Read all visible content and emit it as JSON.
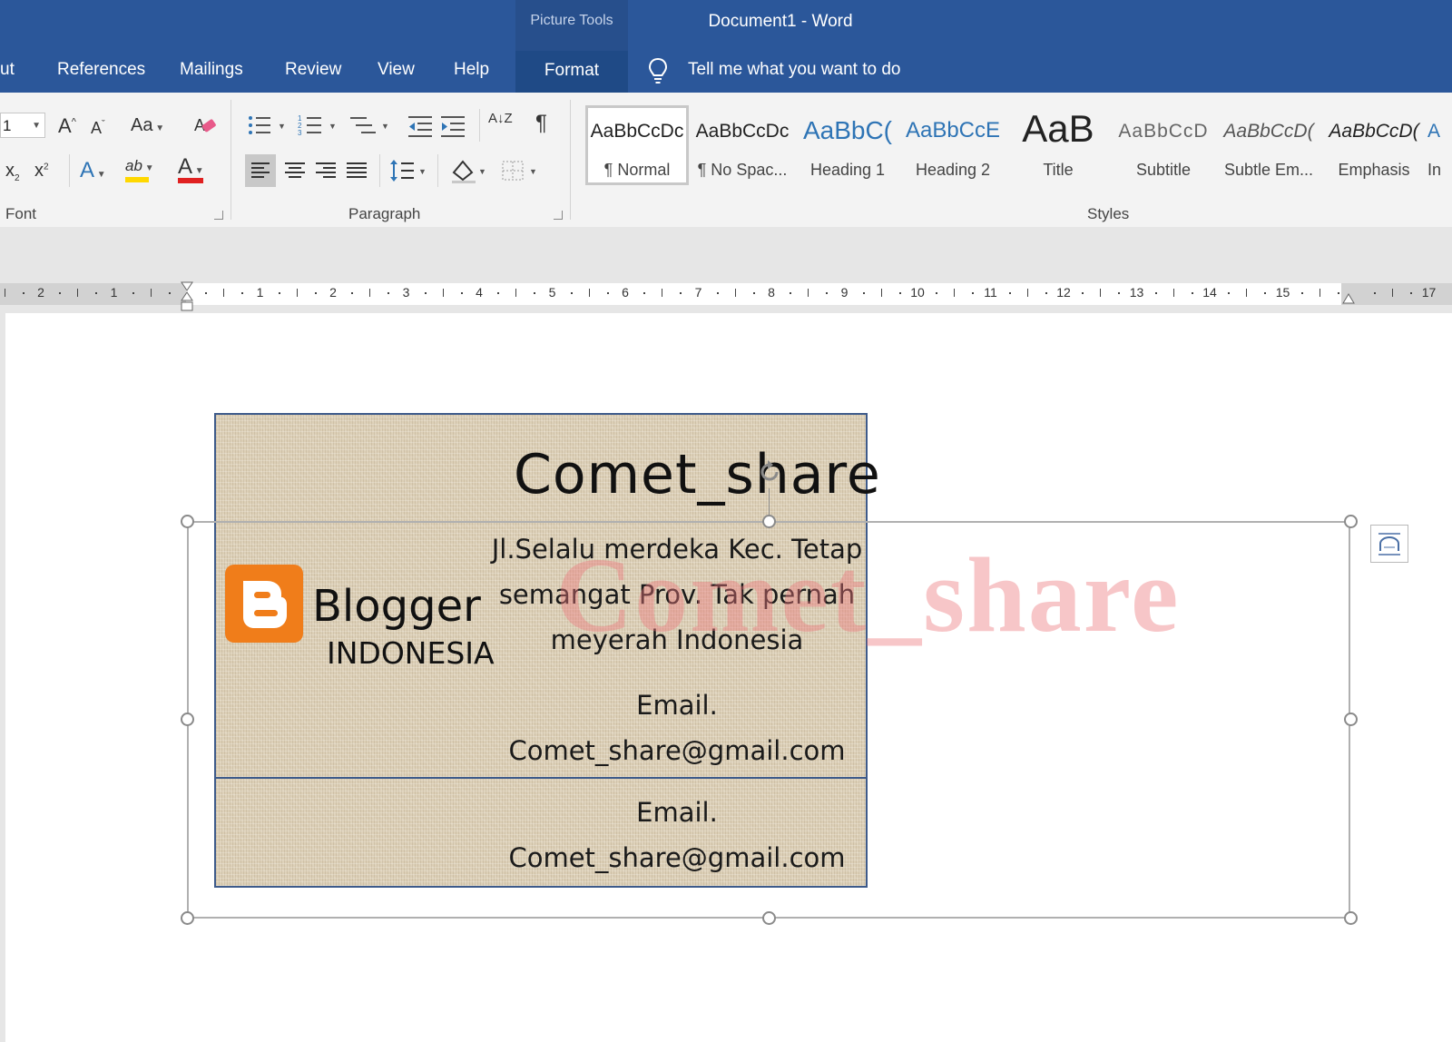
{
  "window": {
    "context_tab_group": "Picture Tools",
    "title": "Document1  -  Word"
  },
  "tabs": {
    "layout_partial": "ut",
    "references": "References",
    "mailings": "Mailings",
    "review": "Review",
    "view": "View",
    "help": "Help",
    "format": "Format",
    "tell_me": "Tell me what you want to do",
    "tell_me_icon": "lightbulb-icon"
  },
  "ribbon": {
    "font": {
      "size_value": "1",
      "grow_label": "A",
      "shrink_label": "A",
      "change_case_label": "Aa",
      "subscript_label": "x",
      "superscript_label": "x",
      "text_effects_label": "A",
      "highlight_label": "ab",
      "font_color_label": "A",
      "group_label": "Font",
      "highlight_color": "#ffd800",
      "font_color": "#e02020"
    },
    "paragraph": {
      "group_label": "Paragraph",
      "sort_label": "A↓Z",
      "show_marks_label": "¶"
    },
    "styles": {
      "group_label": "Styles",
      "items": [
        {
          "sample": "AaBbCcDc",
          "name": "¶ Normal"
        },
        {
          "sample": "AaBbCcDc",
          "name": "¶ No Spac..."
        },
        {
          "sample": "AaBbC(",
          "name": "Heading 1"
        },
        {
          "sample": "AaBbCcE",
          "name": "Heading 2"
        },
        {
          "sample": "AaB",
          "name": "Title"
        },
        {
          "sample": "AaBbCcD",
          "name": "Subtitle"
        },
        {
          "sample": "AaBbCcD(",
          "name": "Subtle Em..."
        },
        {
          "sample": "AaBbCcD(",
          "name": "Emphasis"
        },
        {
          "sample": "A",
          "name": "In"
        }
      ],
      "heading_color": "#2e74b5"
    }
  },
  "ruler": {
    "left_numbers": [
      "2",
      "1"
    ],
    "right_numbers": [
      "1",
      "2",
      "3",
      "4",
      "5",
      "6",
      "7",
      "8",
      "9",
      "10",
      "11",
      "12",
      "13",
      "14",
      "15",
      "17"
    ]
  },
  "document": {
    "card": {
      "title": "Comet_share",
      "address_line1": "Jl.Selalu merdeka Kec. Tetap",
      "address_line2": "semangat Prov. Tak pernah",
      "address_line3": "meyerah Indonesia",
      "email_label": "Email.",
      "email_value": "Comet_share@gmail.com",
      "email_label_2": "Email.",
      "email_value_2": "Comet_share@gmail.com",
      "logo_word": "Blogger",
      "logo_country": "INDONESIA",
      "logo_icon": "blogger-logo-icon",
      "logo_color": "#f07d1a"
    },
    "watermark": "Comet_share"
  }
}
